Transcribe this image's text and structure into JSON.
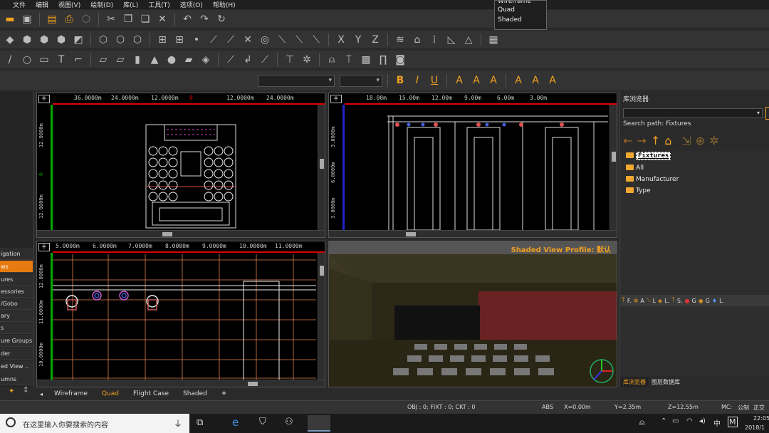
{
  "menu": [
    "文件",
    "编辑",
    "视图(V)",
    "绘制(D)",
    "库(L)",
    "工具(T)",
    "选项(O)",
    "帮助(H)"
  ],
  "view_dropdown": {
    "items": [
      "Wireframe",
      "Quad",
      "Shaded"
    ]
  },
  "format_toolbar": {
    "bold": "B",
    "italic": "I",
    "underline": "U"
  },
  "views": {
    "top_left": {
      "ruler_h": [
        "36.0000m",
        "24.0000m",
        "12.0000m",
        "0",
        "12.0000m",
        "24.0000m"
      ],
      "ruler_v": [
        "12.0000m",
        "0",
        "12.0000m"
      ]
    },
    "top_right": {
      "ruler_h": [
        "18.00m",
        "15.00m",
        "12.00m",
        "9.00m",
        "6.00m",
        "3.00m"
      ],
      "ruler_v": [
        "3.0000m",
        "6.0000m",
        "3.0000m"
      ]
    },
    "bottom_left": {
      "ruler_h": [
        "5.0000m",
        "6.0000m",
        "7.0000m",
        "8.0000m",
        "9.0000m",
        "10.0000m",
        "11.0000m"
      ],
      "ruler_v": [
        "12.0000m",
        "11.0000m",
        "10.0000m"
      ]
    },
    "bottom_right": {
      "profile_label": "Shaded View Profile: 默认"
    }
  },
  "left_panel": {
    "items": [
      "igation",
      "ws",
      "ures",
      "essories",
      "/Gobo",
      "ary",
      "s",
      "ure Groups",
      "der",
      "ed View ..",
      "umns"
    ],
    "active_index": 1
  },
  "library": {
    "title": "库浏览器",
    "search_path": "Search path: Fixtures",
    "tree": [
      "Fixtures",
      "All",
      "Manufacturer",
      "Type"
    ],
    "bottom_tabs": [
      "F.",
      "A",
      "L",
      "L.",
      "S.",
      "G",
      "G",
      "L."
    ],
    "panel_tabs": [
      "库浏览器",
      "图层数据库"
    ]
  },
  "view_tabs": {
    "items": [
      "Wireframe",
      "Quad",
      "Flight Case",
      "Shaded",
      "+"
    ],
    "active": "Quad"
  },
  "status": {
    "obj": "OBJ : 0; FIXT : 0; CKT : 0",
    "abs": "ABS",
    "x": "X=0.00m",
    "y": "Y=2.35m",
    "z": "Z=12.55m",
    "mc": "MC:",
    "unit": "公制",
    "lang": "正交"
  },
  "taskbar": {
    "search_placeholder": "在这里输入你要搜索的内容",
    "time": "22:05",
    "date": "2018/1",
    "ime": "中",
    "m": "M"
  },
  "colors": {
    "accent": "#f0a020",
    "active_tab": "#e77a10",
    "ruler_red": "#dd0000",
    "ruler_green": "#00aa00"
  }
}
